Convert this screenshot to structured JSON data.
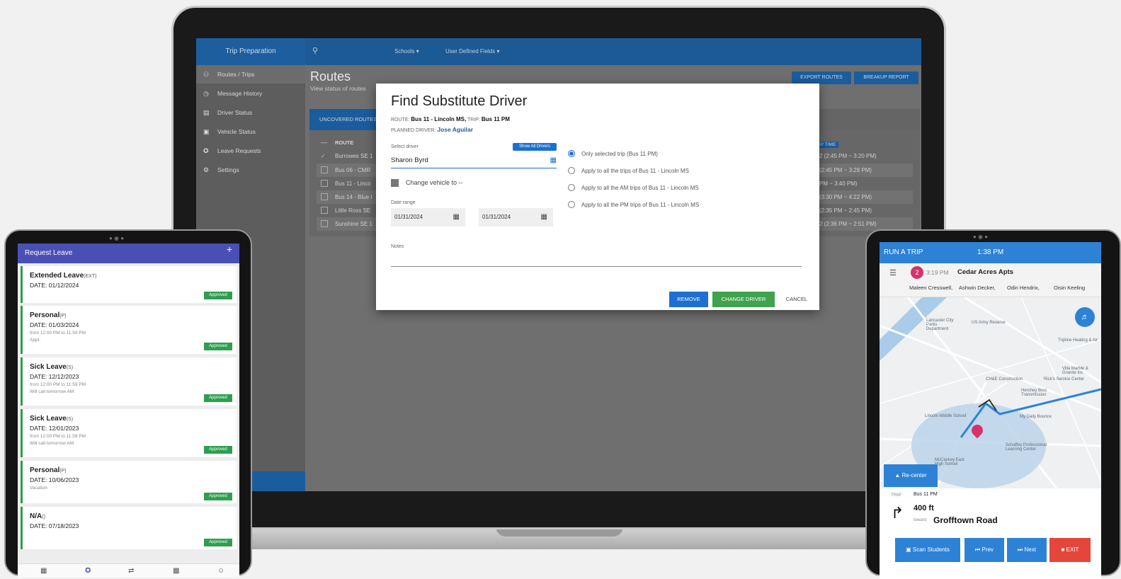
{
  "app": {
    "brand": "Trip Preparation",
    "menus": [
      "Schools",
      "User Defined Fields"
    ],
    "sidebar": [
      {
        "label": "Routes / Trips",
        "icon": "people-icon"
      },
      {
        "label": "Message History",
        "icon": "history-icon"
      },
      {
        "label": "Driver Status",
        "icon": "id-card-icon"
      },
      {
        "label": "Vehicle Status",
        "icon": "bus-icon"
      },
      {
        "label": "Leave Requests",
        "icon": "walking-icon"
      },
      {
        "label": "Settings",
        "icon": "gear-icon"
      }
    ],
    "page_title": "Routes",
    "page_subtitle": "View status of routes",
    "export_label": "EXPORT ROUTES",
    "breakup_label": "BREAKUP REPORT",
    "tab_label": "UNCOVERED ROUTES",
    "route_header": "ROUTE",
    "time_header": "AY TIME",
    "routes": [
      {
        "name": "Burrowes SE 1",
        "time": "2 (2:45 PM ~ 3:20 PM)",
        "checked": true
      },
      {
        "name": "Bus 06 - CMR",
        "time": "(2:45 PM ~ 3:28 PM)",
        "checked": false
      },
      {
        "name": "Bus 11 - Linco",
        "time": "PM ~ 3:40 PM)",
        "checked": false
      },
      {
        "name": "Bus 14 - Blue I",
        "time": "(3:30 PM ~ 4:22 PM)",
        "checked": false
      },
      {
        "name": "Little Ross SE",
        "time": "(2:35 PM ~ 2:45 PM)",
        "checked": false
      },
      {
        "name": "Sunshine SE 1",
        "time": "2 (2:36 PM ~ 2:51 PM)",
        "checked": false
      }
    ]
  },
  "dialog": {
    "title": "Find Substitute Driver",
    "route_label": "ROUTE:",
    "route_value": "Bus 11 - Lincoln MS,",
    "trip_label": "TRIP:",
    "trip_value": "Bus 11 PM",
    "planned_label": "PLANNED DRIVER:",
    "planned_value": "Jose Aguilar",
    "select_driver_label": "Select driver",
    "show_all_label": "Show All Drivers",
    "selected_driver": "Sharon Byrd",
    "change_vehicle_label": "Change vehicle to --",
    "date_range_label": "Date range",
    "date_from": "01/31/2024",
    "date_to": "01/31/2024",
    "options": [
      {
        "label": "Only selected trip (Bus 11 PM)",
        "selected": true
      },
      {
        "label": "Apply to all the trips of Bus 11 - Lincoln MS",
        "selected": false
      },
      {
        "label": "Apply to all the AM trips of Bus 11 - Lincoln MS",
        "selected": false
      },
      {
        "label": "Apply to all the PM trips of Bus 11 - Lincoln MS",
        "selected": false
      }
    ],
    "notes_label": "Notes",
    "remove_label": "REMOVE",
    "change_label": "CHANGE DRIVER",
    "cancel_label": "CANCEL",
    "colors": {
      "primary": "#1d6fd0",
      "success": "#3fa34d"
    }
  },
  "leave": {
    "title": "Request Leave",
    "items": [
      {
        "type": "Extended Leave",
        "code": "(EXT)",
        "date": "DATE: 01/12/2024",
        "from": "",
        "note": "",
        "status": "Approved"
      },
      {
        "type": "Personal",
        "code": "(P)",
        "date": "DATE: 01/03/2024",
        "from": "from 12:00 PM to 11:59 PM",
        "note": "Appt.",
        "status": "Approved"
      },
      {
        "type": "Sick Leave",
        "code": "(S)",
        "date": "DATE: 12/12/2023",
        "from": "from 12:00 PM to 11:59 PM",
        "note": "Will call tomorrow AM",
        "status": "Approved"
      },
      {
        "type": "Sick Leave",
        "code": "(S)",
        "date": "DATE: 12/01/2023",
        "from": "from 12:00 PM to 11:59 PM",
        "note": "Will call tomorrow AM",
        "status": "Approved"
      },
      {
        "type": "Personal",
        "code": "(P)",
        "date": "DATE: 10/06/2023",
        "from": "",
        "note": "Vacation",
        "status": "Approved"
      },
      {
        "type": "N/A",
        "code": "()",
        "date": "DATE: 07/18/2023",
        "from": "",
        "note": "",
        "status": "Approved"
      }
    ],
    "nav_icons": [
      "calendar-icon",
      "walking-icon",
      "swap-icon",
      "fuel-icon",
      "account-icon"
    ]
  },
  "trip": {
    "header": "RUN A TRIP",
    "time": "1:38 PM",
    "stop_number": "2",
    "stop_time": "3:19 PM",
    "stop_name": "Cedar Acres Apts",
    "students": [
      "Maleen Cresswell,",
      "Ashwin Decker,",
      "Odin Hendrix,",
      "Oisin Keeling"
    ],
    "map_labels": [
      "Lancaster City Parks Department",
      "US Army Reserve",
      "Tripline Heating & Air",
      "CH&E Construction",
      "Rick's Service Center",
      "Hershey Bros Transmission",
      "Lincoln Middle School",
      "My Daily Bounce",
      "Schaffey Professional Learning Center",
      "McCaskey East High School",
      "Villa Marble & Granite Inc"
    ],
    "recenter_label": "Re-center",
    "trip_label": "TRIP",
    "trip_value": "Bus 11 PM",
    "distance": "400 ft",
    "toward_label": "toward",
    "road": "Grofftown Road",
    "scan_label": "Scan Students",
    "prev_label": "Prev",
    "next_label": "Next",
    "exit_label": "EXIT",
    "colors": {
      "header": "#2d82d6",
      "exit": "#e4463b",
      "pin": "#d6336c"
    }
  }
}
